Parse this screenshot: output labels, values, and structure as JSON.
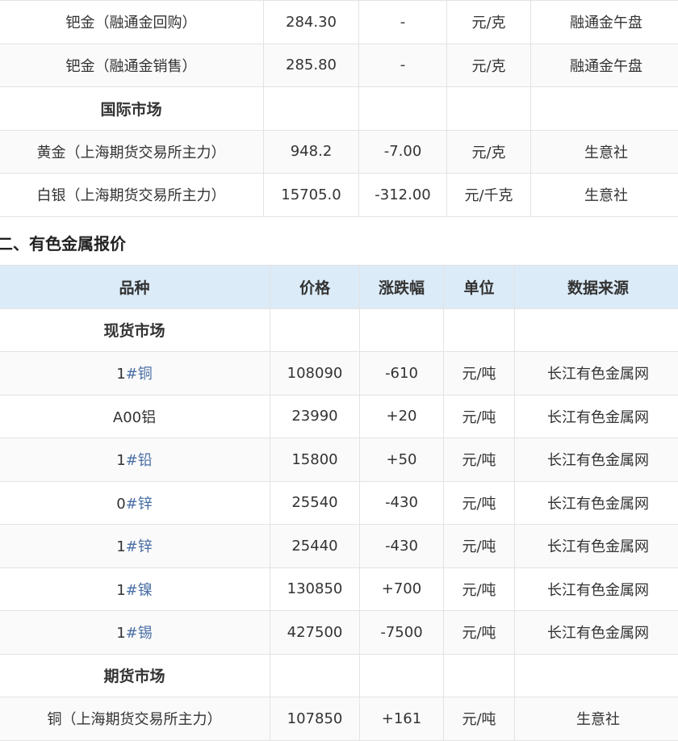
{
  "precious_metals": {
    "rows": [
      {
        "name": "钯金（融通金回购）",
        "price": "284.30",
        "change": "-",
        "unit": "元/克",
        "source": "融通金午盘"
      },
      {
        "name": "钯金（融通金销售）",
        "price": "285.80",
        "change": "-",
        "unit": "元/克",
        "source": "融通金午盘"
      }
    ],
    "intl_section": "国际市场",
    "intl_rows": [
      {
        "name": "黄金（上海期货交易所主力）",
        "price": "948.2",
        "change": "-7.00",
        "unit": "元/克",
        "source": "生意社"
      },
      {
        "name": "白银（上海期货交易所主力）",
        "price": "15705.0",
        "change": "-312.00",
        "unit": "元/千克",
        "source": "生意社"
      }
    ]
  },
  "nonferrous": {
    "heading": "二、有色金属报价",
    "headers": {
      "name": "品种",
      "price": "价格",
      "change": "涨跌幅",
      "unit": "单位",
      "source": "数据来源"
    },
    "spot_section": "现货市场",
    "spot_rows": [
      {
        "prefix": "1",
        "hash": "#",
        "metal": "铜",
        "price": "108090",
        "change": "-610",
        "unit": "元/吨",
        "source": "长江有色金属网"
      },
      {
        "prefix": "A00",
        "hash": "",
        "metal": "铝",
        "price": "23990",
        "change": "+20",
        "unit": "元/吨",
        "source": "长江有色金属网"
      },
      {
        "prefix": "1",
        "hash": "#",
        "metal": "铅",
        "price": "15800",
        "change": "+50",
        "unit": "元/吨",
        "source": "长江有色金属网"
      },
      {
        "prefix": "0",
        "hash": "#",
        "metal": "锌",
        "price": "25540",
        "change": "-430",
        "unit": "元/吨",
        "source": "长江有色金属网"
      },
      {
        "prefix": "1",
        "hash": "#",
        "metal": "锌",
        "price": "25440",
        "change": "-430",
        "unit": "元/吨",
        "source": "长江有色金属网"
      },
      {
        "prefix": "1",
        "hash": "#",
        "metal": "镍",
        "price": "130850",
        "change": "+700",
        "unit": "元/吨",
        "source": "长江有色金属网"
      },
      {
        "prefix": "1",
        "hash": "#",
        "metal": "锡",
        "price": "427500",
        "change": "-7500",
        "unit": "元/吨",
        "source": "长江有色金属网"
      }
    ],
    "futures_section": "期货市场",
    "futures_rows": [
      {
        "name": "铜（上海期货交易所主力）",
        "price": "107850",
        "change": "+161",
        "unit": "元/吨",
        "source": "生意社"
      }
    ]
  }
}
